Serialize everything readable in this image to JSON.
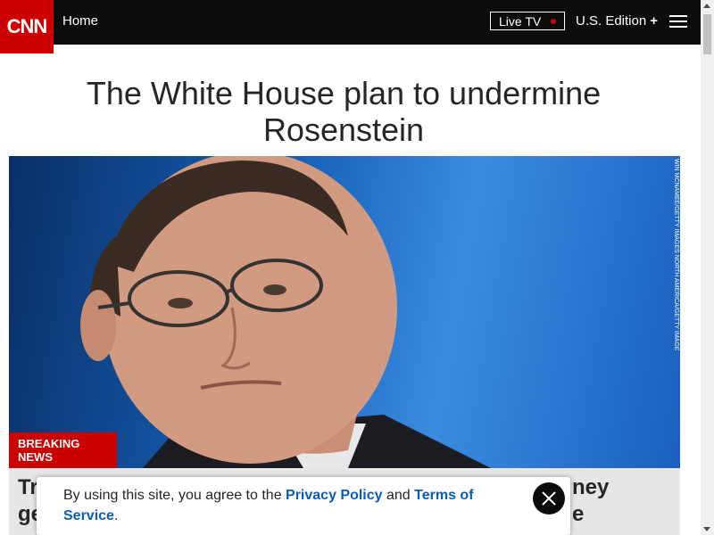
{
  "nav": {
    "logo_text": "CNN",
    "home_label": "Home",
    "live_tv_label": "Live TV",
    "edition_label": "U.S. Edition",
    "edition_plus": "+",
    "menu_icon": "hamburger-menu-icon"
  },
  "article": {
    "headline": "The White House plan to undermine Rosenstein",
    "photo_credit": "WIN MCNAMEE/GETTY IMAGES NORTH AMERICA/GETTY IMAGES",
    "badge": "BREAKING NEWS",
    "breaking_left_1": "Tr",
    "breaking_left_2": "ge",
    "breaking_right_1": "ney",
    "breaking_right_2": "e"
  },
  "cookie": {
    "text_prefix": "By using this site, you agree to the ",
    "privacy_link": "Privacy Policy",
    "middle": " and ",
    "terms_link": "Terms of Service",
    "suffix": "."
  },
  "colors": {
    "brand_red": "#cc0000",
    "nav_black": "#0c0c0c",
    "link_blue": "#0c5db8"
  }
}
